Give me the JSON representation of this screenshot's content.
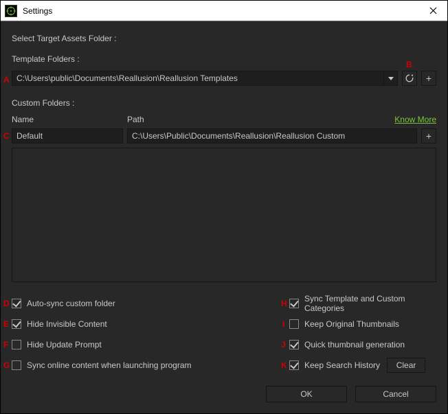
{
  "window": {
    "title": "Settings"
  },
  "labels": {
    "selectTarget": "Select Target Assets Folder :",
    "templateFolders": "Template Folders :",
    "customFolders": "Custom Folders :",
    "colName": "Name",
    "colPath": "Path",
    "knowMore": "Know More"
  },
  "template": {
    "path": "C:\\Users\\public\\Documents\\Reallusion\\Reallusion Templates"
  },
  "custom": {
    "name": "Default",
    "path": "C:\\Users\\Public\\Documents\\Reallusion\\Reallusion Custom"
  },
  "checks": {
    "autoSync": "Auto-sync custom folder",
    "hideInvisible": "Hide Invisible Content",
    "hideUpdate": "Hide Update Prompt",
    "syncOnline": "Sync online content when launching program",
    "syncTemplate": "Sync Template and Custom Categories",
    "keepThumb": "Keep Original Thumbnails",
    "quickThumb": "Quick thumbnail generation",
    "keepSearch": "Keep Search History"
  },
  "buttons": {
    "clear": "Clear",
    "ok": "OK",
    "cancel": "Cancel",
    "plus": "+"
  },
  "markers": {
    "A": "A",
    "B": "B",
    "C": "C",
    "D": "D",
    "E": "E",
    "F": "F",
    "G": "G",
    "H": "H",
    "I": "I",
    "J": "J",
    "K": "K"
  }
}
